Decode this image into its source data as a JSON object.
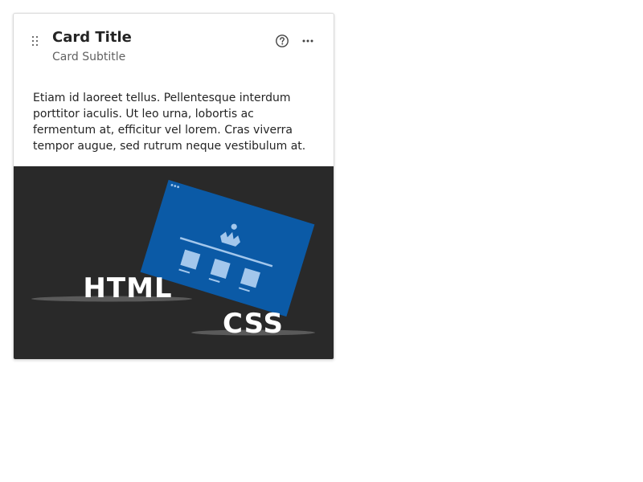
{
  "card": {
    "title": "Card Title",
    "subtitle": "Card Subtitle",
    "body": "Etiam id laoreet tellus. Pellentesque interdum porttitor iaculis. Ut leo urna, lobortis ac fermentum at, efficitur vel lorem. Cras viverra tempor augue, sed rutrum neque vestibulum at.",
    "actions": {
      "help_icon": "help-circle-icon",
      "more_icon": "more-horizontal-icon",
      "drag_icon": "drag-handle-icon"
    },
    "illustration": {
      "html_label": "HTML",
      "css_label": "CSS",
      "background_color": "#292929",
      "window_color": "#0b5aa6",
      "accent_color": "#a3c7ec"
    }
  }
}
